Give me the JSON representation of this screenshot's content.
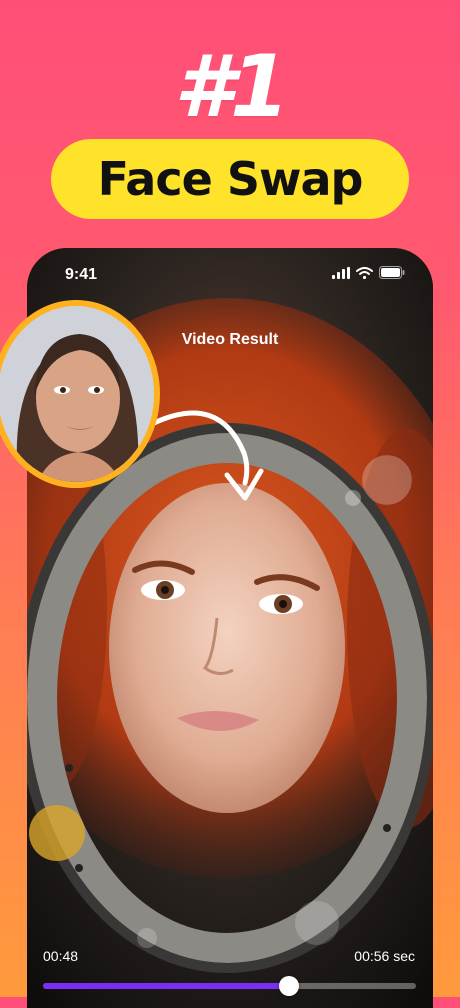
{
  "promo": {
    "rank": "#1",
    "feature": "Face Swap"
  },
  "screen": {
    "status_time": "9:41",
    "title": "Video Result",
    "elapsed": "00:48",
    "duration": "00:56 sec",
    "progress": 0.66
  },
  "colors": {
    "pill": "#ffe22a",
    "avatar_ring": "#ffb11f",
    "progress": "#7b2cf5"
  },
  "icons": [
    "signal-icon",
    "wifi-icon",
    "battery-icon",
    "curved-arrow-icon"
  ]
}
